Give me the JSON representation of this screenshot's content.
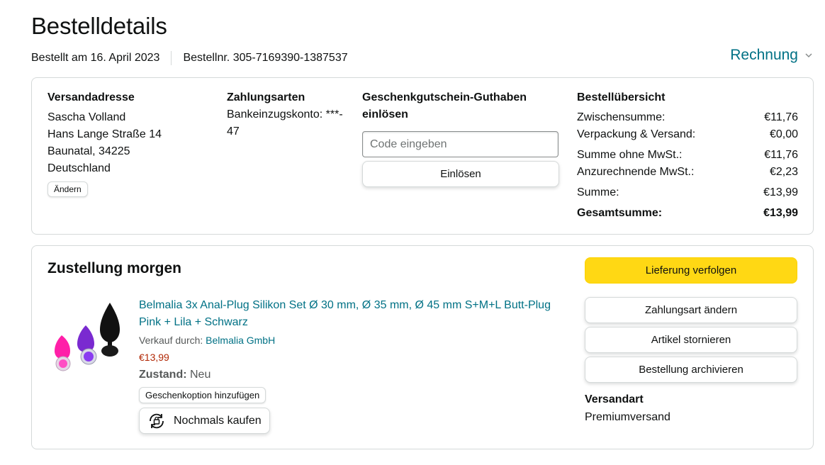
{
  "header": {
    "title": "Bestelldetails",
    "order_date": "Bestellt am 16. April 2023",
    "order_number": "Bestellnr. 305-7169390-1387537",
    "invoice_label": "Rechnung"
  },
  "address": {
    "heading": "Versandadresse",
    "lines": [
      "Sascha Volland",
      "Hans Lange Straße 14",
      "Baunatal, 34225",
      "Deutschland"
    ],
    "change_label": "Ändern"
  },
  "payment": {
    "heading": "Zahlungsarten",
    "line1": "Bankeinzugskonto: ***-",
    "line2": "47"
  },
  "gift": {
    "heading_line1": "Geschenkgutschein-Guthaben",
    "heading_line2": "einlösen",
    "placeholder": "Code eingeben",
    "redeem_label": "Einlösen"
  },
  "summary": {
    "heading": "Bestellübersicht",
    "rows": [
      {
        "label": "Zwischensumme:",
        "value": "€11,76"
      },
      {
        "label": "Verpackung & Versand:",
        "value": "€0,00"
      },
      {
        "label": "Summe ohne MwSt.:",
        "value": "€11,76"
      },
      {
        "label": "Anzurechnende MwSt.:",
        "value": "€2,23"
      },
      {
        "label": "Summe:",
        "value": "€13,99"
      },
      {
        "label": "Gesamtsumme:",
        "value": "€13,99"
      }
    ]
  },
  "delivery": {
    "title": "Zustellung morgen",
    "product": {
      "name": "Belmalia 3x Anal-Plug Silikon Set Ø 30 mm, Ø 35 mm, Ø 45 mm S+M+L Butt-Plug Pink + Lila + Schwarz",
      "sold_by_label": "Verkauf durch:",
      "seller": "Belmalia GmbH",
      "price": "€13,99",
      "condition_label": "Zustand:",
      "condition_value": "Neu",
      "gift_option_label": "Geschenkoption hinzufügen",
      "buy_again_label": "Nochmals kaufen"
    },
    "actions": {
      "track": "Lieferung verfolgen",
      "change_payment": "Zahlungsart ändern",
      "cancel": "Artikel stornieren",
      "archive": "Bestellung archivieren"
    },
    "shipping": {
      "heading": "Versandart",
      "value": "Premiumversand"
    }
  },
  "colors": {
    "link": "#007185",
    "price": "#b12704",
    "primary_button": "#ffd814",
    "border": "#d5d9d9"
  },
  "icons": [
    "chevron-down-icon",
    "buy-again-icon"
  ]
}
